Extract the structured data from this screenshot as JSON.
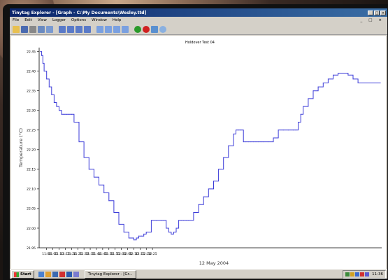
{
  "window": {
    "title": "Tinytag Explorer - [Graph - C:\\My Documents\\Wesley.ttd]",
    "controls": [
      "_",
      "□",
      "×"
    ]
  },
  "menu": [
    "File",
    "Edit",
    "View",
    "Logger",
    "Options",
    "Window",
    "Help"
  ],
  "taskbar": {
    "start_label": "Start",
    "task_label": "Tinytag Explorer - [Gr...",
    "clock": "11:36"
  },
  "colors": {
    "series": "#3a3ad8",
    "titlebar": "#0a246a",
    "face": "#d4d0c8"
  },
  "chart_data": {
    "type": "line",
    "title": "Holdover Test 04",
    "ylabel": "Temperature (°C)",
    "xlabel": "12 May 2004",
    "x_ticks": [
      "11:00",
      "11:05",
      "11:10",
      "11:15",
      "11:20",
      "11:25",
      "11:30",
      "11:35",
      "11:40",
      "11:45",
      "11:50",
      "11:55",
      "12:00",
      "12:05",
      "12:10",
      "12:15",
      "12:20",
      "12:25"
    ],
    "y_ticks": [
      "21.95",
      "22.00",
      "22.05",
      "22.10",
      "22.15",
      "22.20",
      "22.25",
      "22.30",
      "22.35",
      "22.40",
      "22.45"
    ],
    "ylim": [
      21.95,
      22.46
    ],
    "xlim_minutes": [
      -6,
      269
    ],
    "series": [
      {
        "x": [
          -5,
          -4,
          -3,
          -2,
          0,
          2,
          4,
          6,
          8,
          10,
          12,
          14,
          16,
          18,
          20,
          22,
          26,
          30,
          34,
          38,
          42,
          46,
          50,
          54,
          58,
          62,
          66,
          70,
          72,
          74,
          76,
          78,
          80,
          84,
          88,
          92,
          94,
          96,
          98,
          100,
          102,
          104,
          106,
          108,
          110,
          112,
          114,
          118,
          122,
          126,
          130,
          134,
          138,
          142,
          146,
          150,
          152,
          154,
          156,
          158,
          160,
          162,
          164,
          166,
          168,
          170,
          172,
          174,
          178,
          182,
          186,
          190,
          194,
          198,
          200,
          202,
          204,
          206,
          210,
          214,
          218,
          222,
          226,
          230,
          234,
          238,
          242,
          246,
          250,
          254,
          258,
          262,
          266,
          268
        ],
        "y": [
          22.45,
          22.44,
          22.42,
          22.4,
          22.38,
          22.36,
          22.34,
          22.32,
          22.31,
          22.3,
          22.29,
          22.29,
          22.29,
          22.29,
          22.29,
          22.27,
          22.22,
          22.18,
          22.15,
          22.13,
          22.11,
          22.09,
          22.07,
          22.04,
          22.01,
          21.99,
          21.975,
          21.97,
          21.975,
          21.98,
          21.98,
          21.985,
          21.99,
          22.02,
          22.02,
          22.02,
          22.02,
          22.0,
          21.99,
          21.985,
          21.99,
          22.0,
          22.02,
          22.02,
          22.02,
          22.02,
          22.02,
          22.04,
          22.06,
          22.08,
          22.1,
          22.12,
          22.15,
          22.18,
          22.21,
          22.24,
          22.25,
          22.25,
          22.25,
          22.22,
          22.22,
          22.22,
          22.22,
          22.22,
          22.22,
          22.22,
          22.22,
          22.22,
          22.22,
          22.23,
          22.25,
          22.25,
          22.25,
          22.25,
          22.25,
          22.27,
          22.29,
          22.31,
          22.33,
          22.35,
          22.36,
          22.37,
          22.38,
          22.39,
          22.395,
          22.395,
          22.39,
          22.38,
          22.37,
          22.37,
          22.37,
          22.37,
          22.37,
          22.37
        ]
      }
    ],
    "grid": false,
    "legend": "none"
  }
}
